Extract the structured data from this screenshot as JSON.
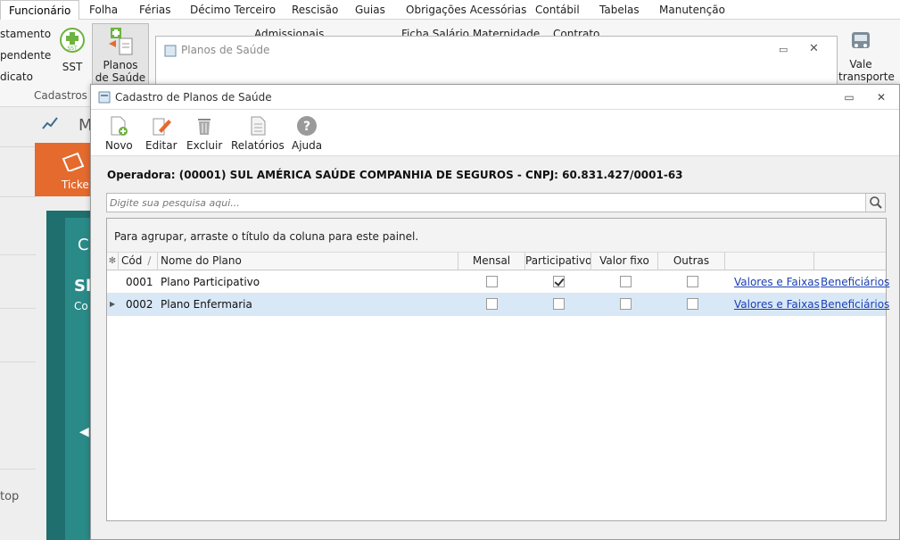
{
  "ribbon": {
    "tabs": [
      "Funcionário",
      "Folha",
      "Férias",
      "Décimo Terceiro",
      "Rescisão",
      "Guias",
      "Obrigações Acessórias",
      "Contábil",
      "Tabelas",
      "Manutenção"
    ],
    "side_items": [
      "stamento",
      "pendente",
      "dicato"
    ],
    "sst_label": "SST",
    "planos_label_1": "Planos",
    "planos_label_2": "de Saúde",
    "group_label": "Cadastros",
    "admissionais": "Admissionais",
    "ficha_salario": "Ficha Salário Maternidade",
    "contrato": "Contrato",
    "vale_label_1": "Vale",
    "vale_label_2": "transporte"
  },
  "left": {
    "tile_label": "Ticke",
    "card_letters": [
      "C",
      "Sl",
      "Co"
    ],
    "bottom_text": "top",
    "m_text": "M"
  },
  "bg_window": {
    "title": "Planos de Saúde"
  },
  "dialog": {
    "title": "Cadastro de Planos de Saúde",
    "toolbar": {
      "novo": "Novo",
      "editar": "Editar",
      "excluir": "Excluir",
      "relatorios": "Relatórios",
      "ajuda": "Ajuda"
    },
    "operator": "Operadora: (00001) SUL AMÉRICA SAÚDE COMPANHIA DE SEGUROS - CNPJ: 60.831.427/0001-63",
    "search_placeholder": "Digite sua pesquisa aqui...",
    "group_hint": "Para agrupar, arraste o título da coluna para este painel.",
    "columns": {
      "cod": "Cód",
      "nome": "Nome do Plano",
      "mensal": "Mensal",
      "participativo": "Participativo",
      "valor_fixo": "Valor fixo",
      "outras": "Outras"
    },
    "rows": [
      {
        "cod": "0001",
        "nome": "Plano Participativo",
        "mensal": false,
        "participativo": true,
        "valor_fixo": false,
        "outras": false,
        "link1": "Valores e Faixas",
        "link2": "Beneficiários"
      },
      {
        "cod": "0002",
        "nome": "Plano Enfermaria",
        "mensal": false,
        "participativo": false,
        "valor_fixo": false,
        "outras": false,
        "link1": "Valores e Faixas",
        "link2": "Beneficiários"
      }
    ]
  }
}
